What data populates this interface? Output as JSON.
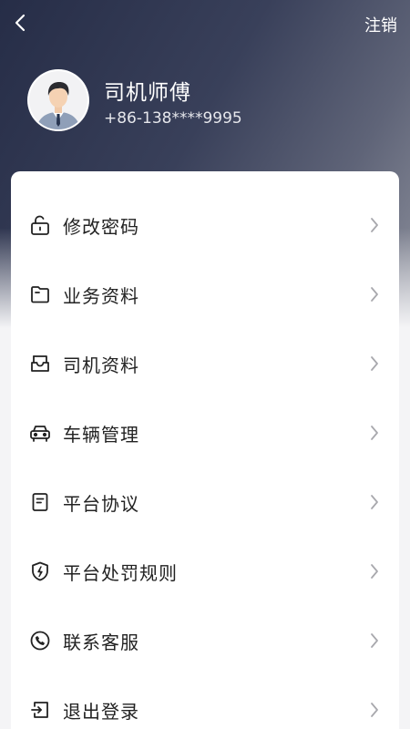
{
  "header": {
    "logout_label": "注销",
    "back_icon": "chevron-left-icon"
  },
  "user": {
    "name": "司机师傅",
    "phone": "+86-138****9995",
    "avatar": "avatar-man-in-suit"
  },
  "menu": {
    "items": [
      {
        "label": "修改密码",
        "icon": "lock-icon"
      },
      {
        "label": "业务资料",
        "icon": "folder-icon"
      },
      {
        "label": "司机资料",
        "icon": "inbox-icon"
      },
      {
        "label": "车辆管理",
        "icon": "car-icon"
      },
      {
        "label": "平台协议",
        "icon": "document-icon"
      },
      {
        "label": "平台处罚规则",
        "icon": "shield-bolt-icon"
      },
      {
        "label": "联系客服",
        "icon": "phone-icon"
      },
      {
        "label": "退出登录",
        "icon": "exit-icon"
      }
    ]
  },
  "colors": {
    "header_dark": "#262d47",
    "header_light": "#8d909c",
    "card": "#ffffff",
    "page_bg": "#f4f4f6",
    "text": "#222222",
    "chevron": "#a8a8ad"
  }
}
